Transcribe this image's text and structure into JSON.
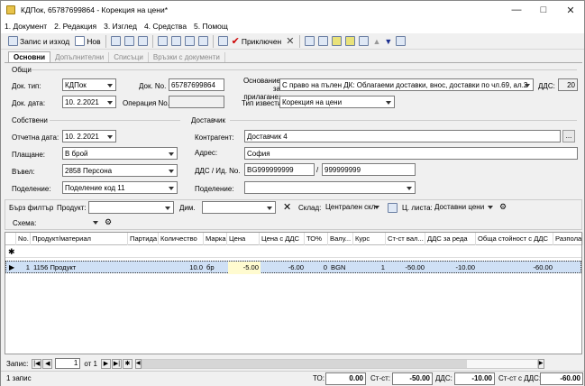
{
  "window": {
    "title": "КДПок, 65787699864 - Корекция на цени*"
  },
  "menu": [
    "1. Документ",
    "2. Редакция",
    "3. Изглед",
    "4. Средства",
    "5. Помощ"
  ],
  "toolbar": {
    "save_exit": "Запис и изход",
    "new": "Нов",
    "confirmed": "Приключен"
  },
  "tabs": [
    "Основни",
    "Допълнителни",
    "Списъци",
    "Връзки с документи"
  ],
  "general": {
    "section": "Общи",
    "doc_type_label": "Док. тип:",
    "doc_type": "КДПок",
    "doc_no_label": "Док. No.",
    "doc_no": "65787699864",
    "basis_label": "Основание за прилагане:",
    "basis": "С право на пълен ДК: Облагаеми доставки, внос, доставки по чл.69, ал.2",
    "vat_label": "ДДС:",
    "vat": "20",
    "doc_date_label": "Док. дата:",
    "doc_date": "10. 2.2021",
    "op_no_label": "Операция No.",
    "op_no": "",
    "notice_label": "Тип известие:",
    "notice": "Корекция на цени"
  },
  "own": {
    "section": "Собствени",
    "report_date_label": "Отчетна дата:",
    "report_date": "10. 2.2021",
    "payment_label": "Плащане:",
    "payment": "В брой",
    "entered_label": "Въвел:",
    "entered": "2858 Персона",
    "division_label": "Поделение:",
    "division": "Поделение код 11"
  },
  "supplier": {
    "section": "Доставчик",
    "contractor_label": "Контрагент:",
    "contractor": "Доставчик 4",
    "address_label": "Адрес:",
    "address": "София",
    "vat_id_label": "ДДС / Ид. No.",
    "vat_no": "BG999999999",
    "id_no": "999999999",
    "division_label": "Поделение:",
    "division": ""
  },
  "filter": {
    "quick_label": "Бърз филтър",
    "product_label": "Продукт:",
    "dim_label": "Дим.",
    "warehouse_label": "Склад:",
    "warehouse": "Централен скл",
    "price_list_label": "Ц. листа:",
    "price_list": "Доставни цени",
    "scheme_label": "Схема:"
  },
  "grid": {
    "columns": [
      "No.",
      "Продукт/материал",
      "Партида",
      "Количество",
      "Марка",
      "Цена",
      "Цена с ДДС",
      "ТО%",
      "Валу...",
      "Курс",
      "Ст-ст вал...",
      "ДДС за реда",
      "Обща стойност с ДДС",
      "Разпола"
    ],
    "rows": [
      [
        "1",
        "1156 Продукт",
        "",
        "10.0",
        "бр",
        "-5.00",
        "-6.00",
        "0",
        "BGN",
        "1",
        "-50.00",
        "-10.00",
        "-60.00",
        ""
      ]
    ]
  },
  "nav": {
    "label": "Запис:",
    "current": "1",
    "of": "от 1"
  },
  "status": {
    "records": "1 запис",
    "to_label": "ТО:",
    "to": "0.00",
    "cost_label": "Ст-ст:",
    "cost": "-50.00",
    "vat_label": "ДДС:",
    "vat": "-10.00",
    "total_label": "Ст-ст с ДДС:",
    "total": "-60.00"
  },
  "colors": {
    "selected_row": "#cfe0f5",
    "price_cell": "#fffbd0"
  }
}
